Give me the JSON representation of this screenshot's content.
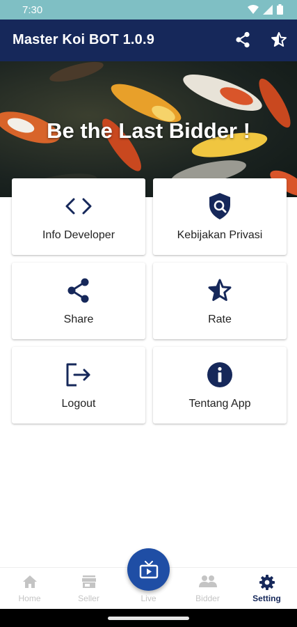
{
  "status_bar": {
    "time": "7:30"
  },
  "app_bar": {
    "title": "Master Koi BOT 1.0.9",
    "actions": [
      {
        "name": "share",
        "icon": "share-icon"
      },
      {
        "name": "rate",
        "icon": "star-half-icon"
      }
    ]
  },
  "hero": {
    "title": "Be the Last Bidder !"
  },
  "menu": [
    {
      "label": "Info Developer",
      "icon": "code-icon"
    },
    {
      "label": "Kebijakan Privasi",
      "icon": "shield-search-icon"
    },
    {
      "label": "Share",
      "icon": "share-icon"
    },
    {
      "label": "Rate",
      "icon": "star-half-icon"
    },
    {
      "label": "Logout",
      "icon": "logout-icon"
    },
    {
      "label": "Tentang App",
      "icon": "info-icon"
    }
  ],
  "bottom_nav": [
    {
      "label": "Home",
      "icon": "home-icon"
    },
    {
      "label": "Seller",
      "icon": "store-icon"
    },
    {
      "label": "Live",
      "icon": "tv-icon"
    },
    {
      "label": "Bidder",
      "icon": "people-icon"
    },
    {
      "label": "Setting",
      "icon": "gear-icon",
      "active": true
    }
  ],
  "colors": {
    "primary": "#16285a",
    "accent": "#1f4ea5",
    "status_bar": "#7fbfc4",
    "inactive": "#c4c4c4"
  }
}
